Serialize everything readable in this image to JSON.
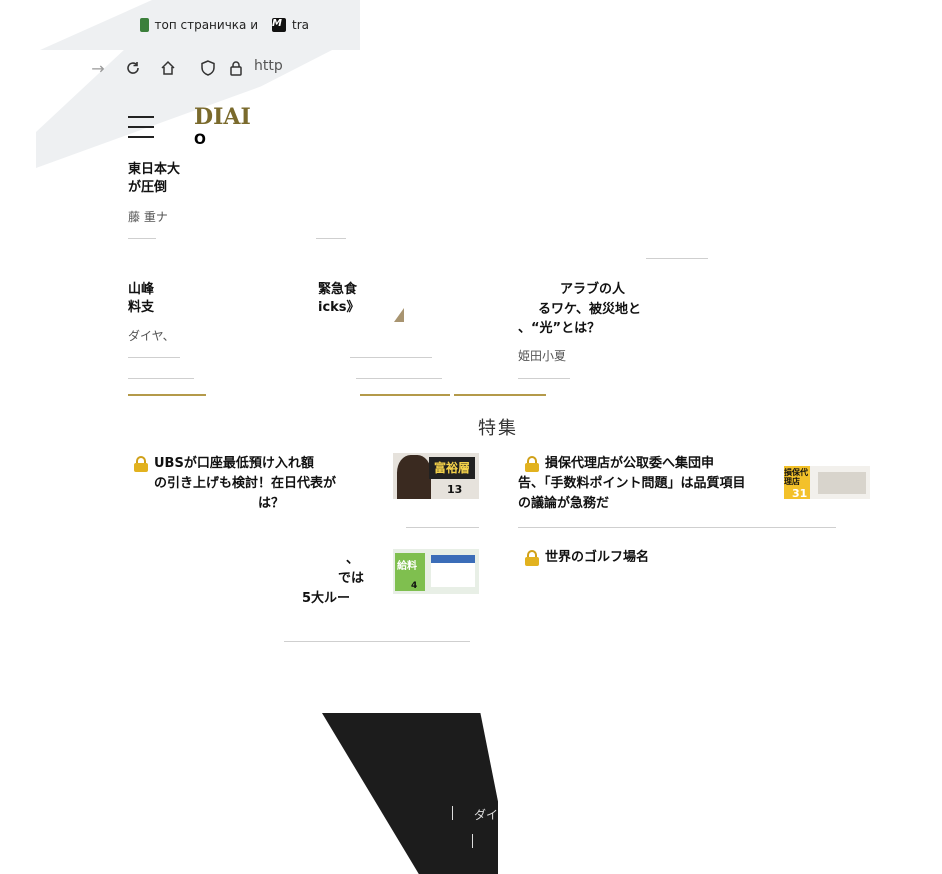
{
  "browser": {
    "tabs": [
      {
        "label": "топ страничка и",
        "favicon": "green-chart-icon"
      },
      {
        "label": "tra",
        "favicon": "m-logo-icon"
      }
    ],
    "url_partial": "http"
  },
  "site": {
    "logo": "DIAI",
    "logo_sub": "O"
  },
  "articles": [
    {
      "title_l1": "東日本大",
      "title_l2": "が圧倒",
      "meta": "藤 重ナ"
    },
    {
      "title_l1": "山峰",
      "title_l2": "料支",
      "title_r1": "緊急食",
      "title_r2": "icks》",
      "meta": "ダイヤ、"
    },
    {
      "title_l1": "アラブの人",
      "title_l2": "るワケ、被災地と",
      "title_l3": "、“光”とは？",
      "meta": "姫田小夏"
    }
  ],
  "feature_section": {
    "title": "特集",
    "items": [
      {
        "title_l1": "UBSが口座最低預け入れ額",
        "title_l2": "の引き上げも検討！在日代表が",
        "title_l3": "は？",
        "badge": "13",
        "thumb_label": "富裕層"
      },
      {
        "title_l1": "損保代理店が公取委へ集団申",
        "title_l2": "告、「手数料ポイント問題」は品質項目",
        "title_l3": "の議論が急務だ",
        "badge": "31",
        "thumb_label": "損保代理店"
      },
      {
        "title_l1": "、",
        "title_l2": "では",
        "title_l3": "5大ルー",
        "badge": "4",
        "thumb_label": "給料"
      },
      {
        "title_l1": "世界のゴルフ場名"
      }
    ]
  },
  "footer": {
    "link": "ダイ"
  }
}
